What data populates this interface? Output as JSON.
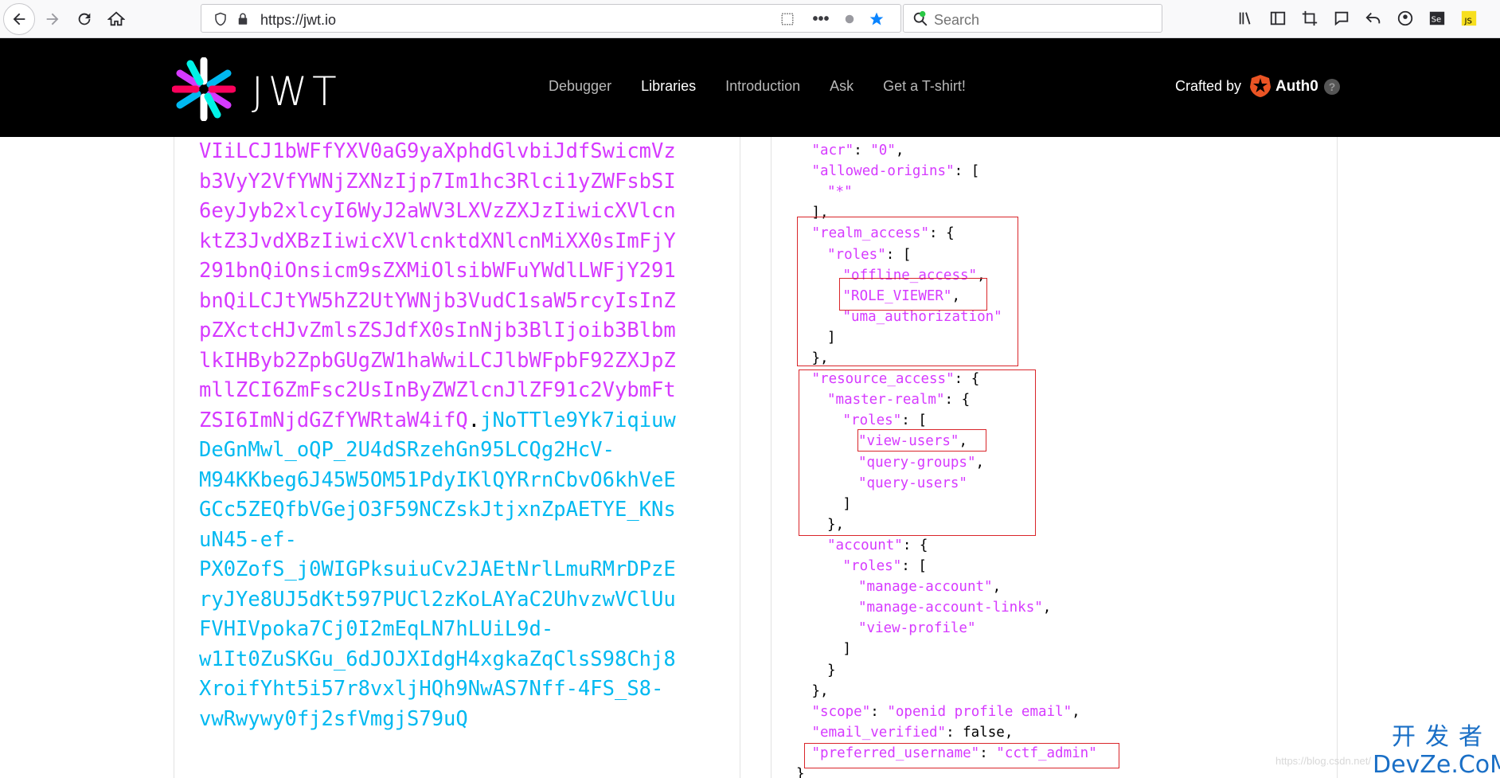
{
  "browser": {
    "url": "https://jwt.io",
    "search_placeholder": "Search"
  },
  "header": {
    "logo_text": "JWT",
    "nav": [
      {
        "label": "Debugger",
        "active": false
      },
      {
        "label": "Libraries",
        "active": true
      },
      {
        "label": "Introduction",
        "active": false
      },
      {
        "label": "Ask",
        "active": false
      },
      {
        "label": "Get a T-shirt!",
        "active": false
      }
    ],
    "crafted_by": "Crafted by",
    "brand": "Auth0",
    "help": "?"
  },
  "token": {
    "payload_lines": [
      "VIiLCJ1bWFfYXV0aG9yaXphdGlvbiJdfSwicmVz",
      "b3VyY2VfYWNjZXNzIjp7Im1hc3Rlci1yZWFsbSI",
      "6eyJyb2xlcyI6WyJ2aWV3LXVzZXJzIiwicXVlcn",
      "ktZ3JvdXBzIiwicXVlcnktdXNlcnMiXX0sImFjY",
      "291bnQiOnsicm9sZXMiOlsibWFuYWdlLWFjY291",
      "bnQiLCJtYW5hZ2UtYWNjb3VudC1saW5rcyIsInZ",
      "pZXctcHJvZmlsZSJdfX0sInNjb3BlIjoib3Blbm",
      "lkIHByb2ZpbGUgZW1haWwiLCJlbWFpbF92ZXJpZ",
      "mllZCI6ZmFsc2UsInByZWZlcnJlZF91c2VybmFt",
      "ZSI6ImNjdGZfYWRtaW4ifQ"
    ],
    "dot": ".",
    "signature_first": "jNoTTle9Yk7iqiuw",
    "signature_lines": [
      "DeGnMwl_oQP_2U4dSRzehGn95LCQg2HcV-",
      "M94KKbeg6J45W5OM51PdyIKlQYRrnCbvO6khVeE",
      "GCc5ZEQfbVGejO3F59NCZskJtjxnZpAETYE_KNs",
      "uN45-ef-",
      "PX0ZofS_j0WIGPksuiuCv2JAEtNrlLmuRMrDPzE",
      "ryJYe8UJ5dKt597PUCl2zKoLAYaC2UhvzwVClUu",
      "FVHIVpoka7Cj0I2mEqLN7hLUiL9d-",
      "w1It0ZuSKGu_6dJOJXIdgH4xgkaZqClsS98Chj8",
      "XroifYht5i57r8vxljHQh9NwAS7Nff-4FS_S8-",
      "vwRwywy0fj2sfVmgjS79uQ"
    ]
  },
  "decoded_lines": [
    {
      "indent": 1,
      "text": "\"acr\": \"0\","
    },
    {
      "indent": 1,
      "text": "\"allowed-origins\": ["
    },
    {
      "indent": 2,
      "text": "\"*\""
    },
    {
      "indent": 1,
      "text": "],"
    },
    {
      "indent": 1,
      "text": "\"realm_access\": {"
    },
    {
      "indent": 2,
      "text": "\"roles\": ["
    },
    {
      "indent": 3,
      "text": "\"offline_access\","
    },
    {
      "indent": 3,
      "text": "\"ROLE_VIEWER\","
    },
    {
      "indent": 3,
      "text": "\"uma_authorization\""
    },
    {
      "indent": 2,
      "text": "]"
    },
    {
      "indent": 1,
      "text": "},"
    },
    {
      "indent": 1,
      "text": "\"resource_access\": {"
    },
    {
      "indent": 2,
      "text": "\"master-realm\": {"
    },
    {
      "indent": 3,
      "text": "\"roles\": ["
    },
    {
      "indent": 4,
      "text": "\"view-users\","
    },
    {
      "indent": 4,
      "text": "\"query-groups\","
    },
    {
      "indent": 4,
      "text": "\"query-users\""
    },
    {
      "indent": 3,
      "text": "]"
    },
    {
      "indent": 2,
      "text": "},"
    },
    {
      "indent": 2,
      "text": "\"account\": {"
    },
    {
      "indent": 3,
      "text": "\"roles\": ["
    },
    {
      "indent": 4,
      "text": "\"manage-account\","
    },
    {
      "indent": 4,
      "text": "\"manage-account-links\","
    },
    {
      "indent": 4,
      "text": "\"view-profile\""
    },
    {
      "indent": 3,
      "text": "]"
    },
    {
      "indent": 2,
      "text": "}"
    },
    {
      "indent": 1,
      "text": "},"
    },
    {
      "indent": 1,
      "text": "\"scope\": \"openid profile email\","
    },
    {
      "indent": 1,
      "text": "\"email_verified\": false,"
    },
    {
      "indent": 1,
      "text": "\"preferred_username\": \"cctf_admin\""
    },
    {
      "indent": 0,
      "text": "}"
    }
  ],
  "watermark": {
    "cn": "开发者",
    "en": "DevZe.CoM",
    "faint": "https://blog.csdn.net/"
  },
  "colors": {
    "payload": "#d63aff",
    "signature": "#00b9f1",
    "highlight": "#d9252a",
    "header_bg": "#000000"
  },
  "icons": [
    "back-icon",
    "forward-icon",
    "reload-icon",
    "home-icon",
    "shield-icon",
    "lock-icon",
    "qr-icon",
    "more-icon",
    "bug-icon",
    "star-icon",
    "search-icon",
    "library-icon",
    "sidebar-icon",
    "crop-icon",
    "chat-icon",
    "undo-icon",
    "account-icon",
    "selenium-icon",
    "js-icon",
    "auth0-icon",
    "help-icon"
  ]
}
